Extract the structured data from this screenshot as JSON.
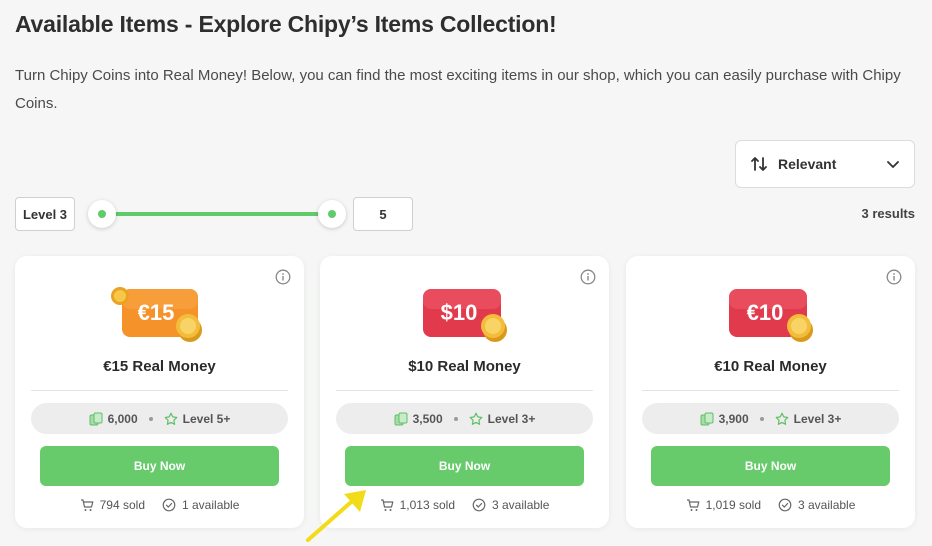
{
  "header": {
    "title": "Available Items - Explore Chipy’s Items Collection!",
    "description": "Turn Chipy Coins into Real Money! Below, you can find the most exciting items in our shop, which you can easily purchase with Chipy Coins."
  },
  "filters": {
    "sort_label": "Relevant",
    "level_min_label": "Level 3",
    "level_max_value": "5",
    "results": "3 results"
  },
  "colors": {
    "accent_green": "#67cb6b",
    "euro15_orange": "#f5922a",
    "usd10_red": "#e23a4d",
    "annotation_yellow": "#f2dc1a"
  },
  "items": [
    {
      "badge_text": "€15",
      "name": "€15 Real Money",
      "price": "6,000",
      "level": "Level 5+",
      "buy_label": "Buy Now",
      "sold": "794 sold",
      "available": "1 available"
    },
    {
      "badge_text": "$10",
      "name": "$10 Real Money",
      "price": "3,500",
      "level": "Level 3+",
      "buy_label": "Buy Now",
      "sold": "1,013 sold",
      "available": "3 available"
    },
    {
      "badge_text": "€10",
      "name": "€10 Real Money",
      "price": "3,900",
      "level": "Level 3+",
      "buy_label": "Buy Now",
      "sold": "1,019 sold",
      "available": "3 available"
    }
  ]
}
